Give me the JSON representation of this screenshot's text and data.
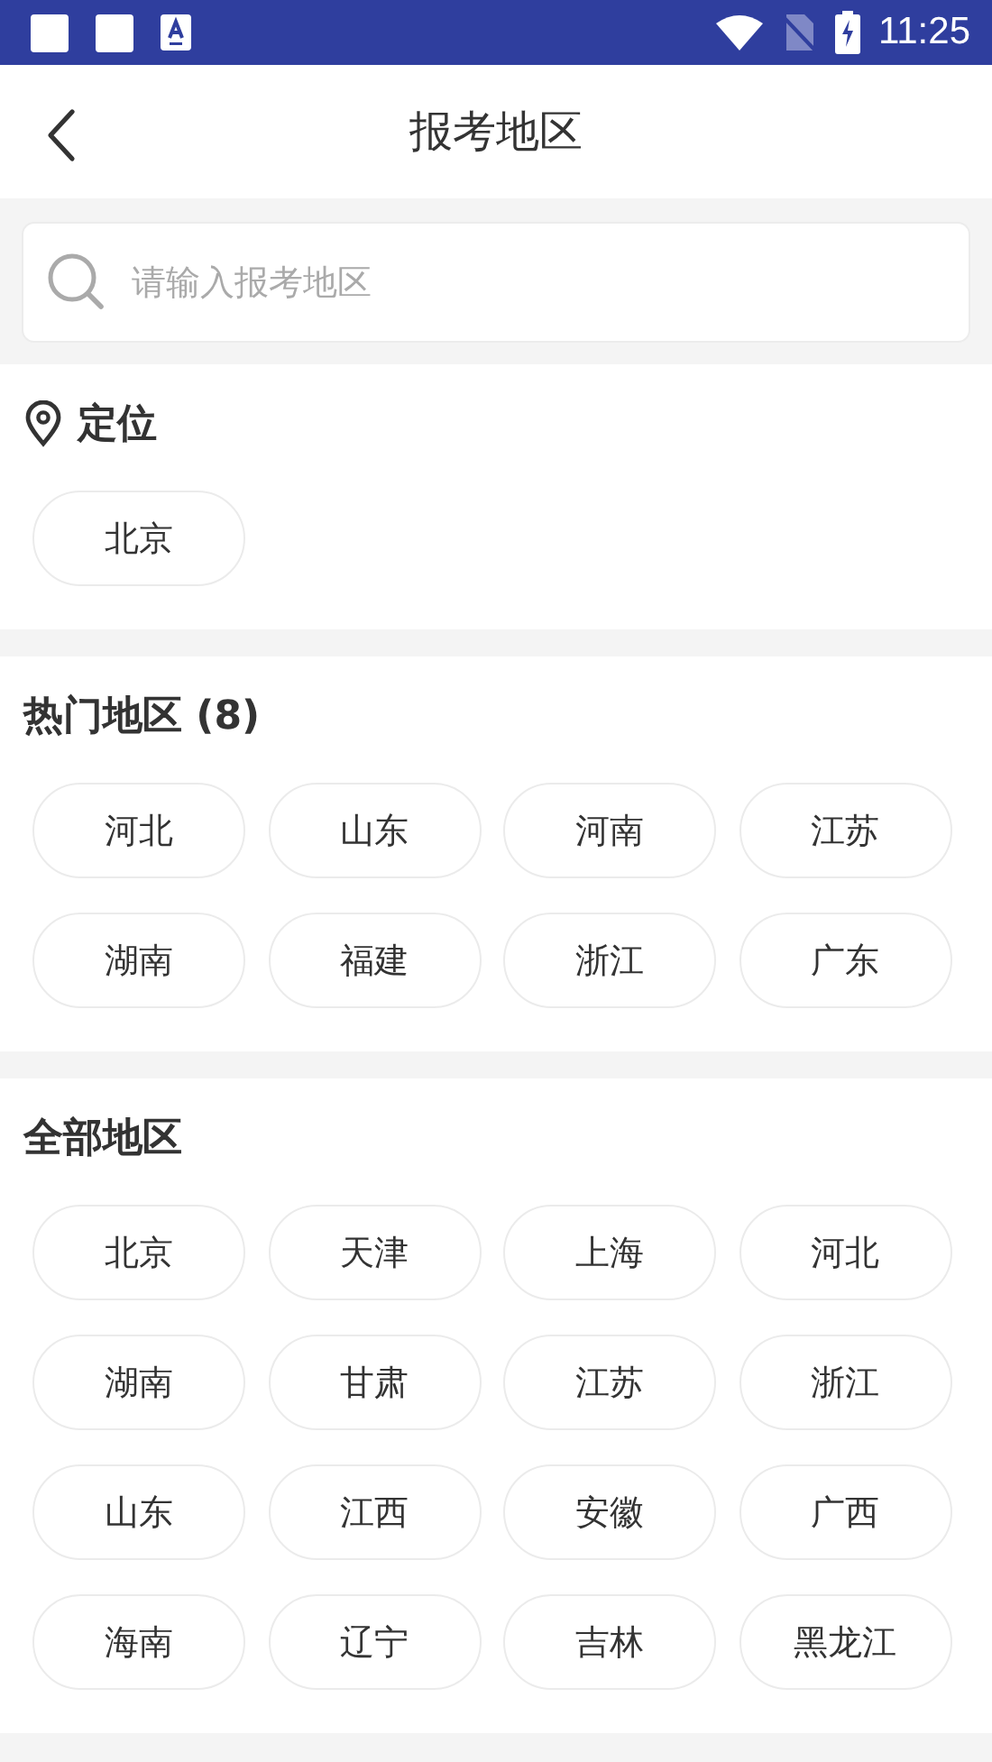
{
  "status_bar": {
    "time": "11:25"
  },
  "header": {
    "title": "报考地区"
  },
  "search": {
    "placeholder": "请输入报考地区"
  },
  "sections": [
    {
      "kind": "location",
      "title": "定位",
      "items": [
        "北京"
      ]
    },
    {
      "kind": "plain",
      "title": "热门地区",
      "count": "(8)",
      "items": [
        "河北",
        "山东",
        "河南",
        "江苏",
        "湖南",
        "福建",
        "浙江",
        "广东"
      ]
    },
    {
      "kind": "plain",
      "title": "全部地区",
      "items": [
        "北京",
        "天津",
        "上海",
        "河北",
        "湖南",
        "甘肃",
        "江苏",
        "浙江",
        "山东",
        "江西",
        "安徽",
        "广西",
        "海南",
        "辽宁",
        "吉林",
        "黑龙江"
      ]
    }
  ]
}
